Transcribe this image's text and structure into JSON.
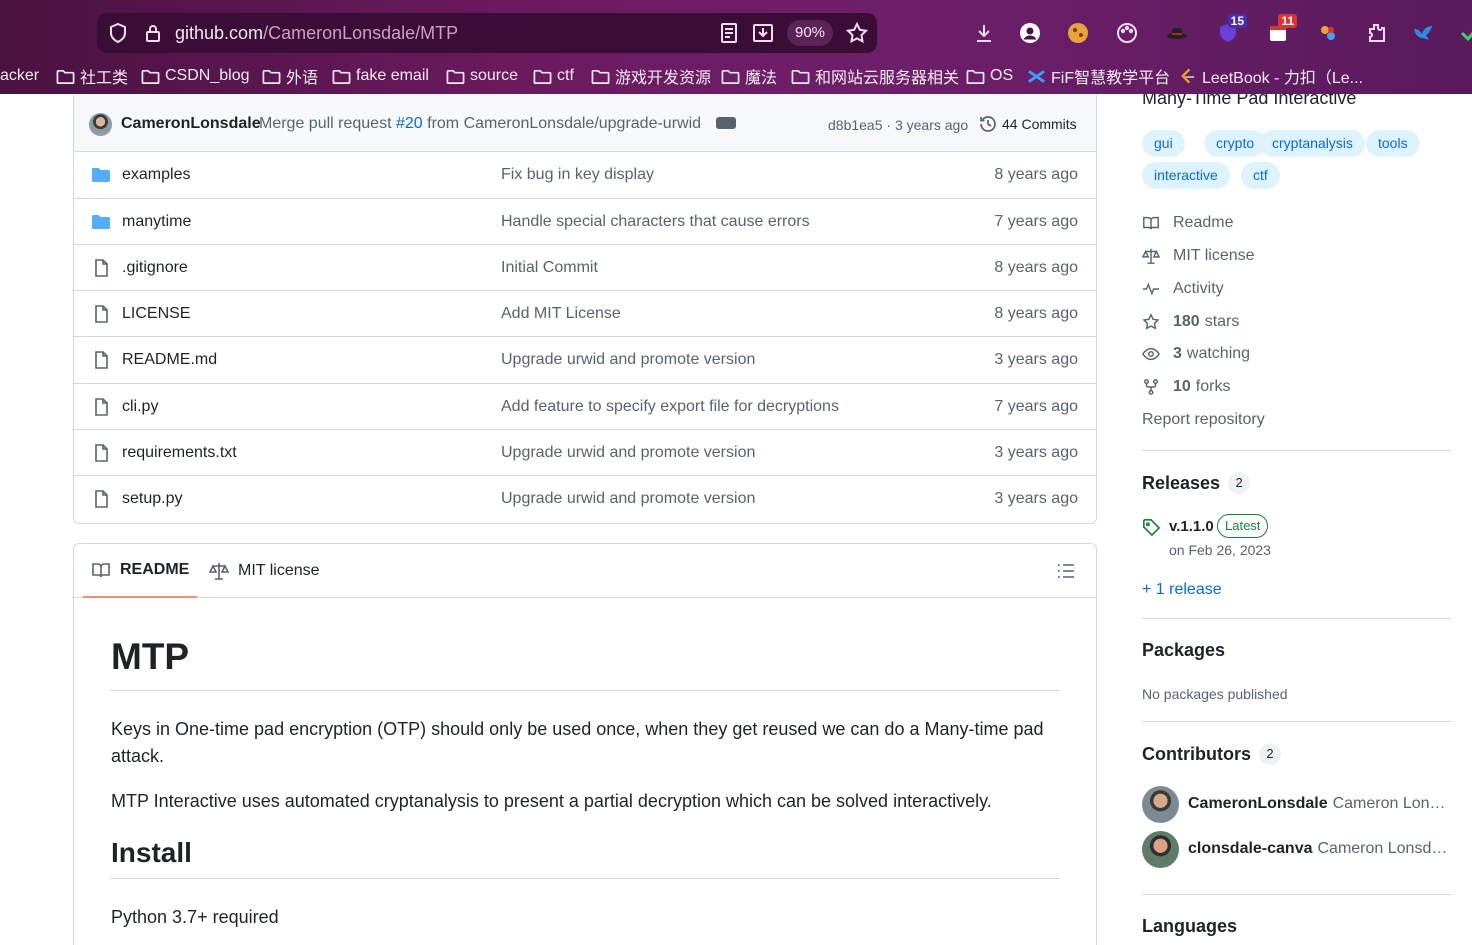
{
  "browser": {
    "url_host": "github.com",
    "url_path": "/CameronLonsdale/MTP",
    "zoom": "90%",
    "extensions": {
      "badge_1": "15",
      "badge_2": "11"
    },
    "bookmarks": [
      {
        "label": "acker",
        "icon": "none"
      },
      {
        "label": "社工类",
        "icon": "folder-icon"
      },
      {
        "label": "CSDN_blog",
        "icon": "folder-icon"
      },
      {
        "label": "外语",
        "icon": "folder-icon"
      },
      {
        "label": "fake email",
        "icon": "folder-icon"
      },
      {
        "label": "source",
        "icon": "folder-icon"
      },
      {
        "label": "ctf",
        "icon": "folder-icon"
      },
      {
        "label": "游戏开发资源",
        "icon": "folder-icon"
      },
      {
        "label": "魔法",
        "icon": "folder-icon"
      },
      {
        "label": "和网站云服务器相关",
        "icon": "folder-icon"
      },
      {
        "label": "OS",
        "icon": "folder-icon"
      },
      {
        "label": "FiF智慧教学平台",
        "icon": "fif-icon"
      },
      {
        "label": "LeetBook - 力扣（Le...",
        "icon": "leetcode-icon"
      }
    ]
  },
  "commit_bar": {
    "user": "CameronLonsdale",
    "message_prefix": "Merge pull request ",
    "pr": "#20",
    "message_suffix": " from CameronLonsdale/upgrade-urwid",
    "sha_age": "d8b1ea5 · 3 years ago",
    "commits": "44 Commits"
  },
  "files": [
    {
      "name": "examples",
      "type": "dir",
      "message": "Fix bug in key display",
      "age": "8 years ago"
    },
    {
      "name": "manytime",
      "type": "dir",
      "message": "Handle special characters that cause errors",
      "age": "7 years ago"
    },
    {
      "name": ".gitignore",
      "type": "file",
      "message": "Initial Commit",
      "age": "8 years ago"
    },
    {
      "name": "LICENSE",
      "type": "file",
      "message": "Add MIT License",
      "age": "8 years ago"
    },
    {
      "name": "README.md",
      "type": "file",
      "message": "Upgrade urwid and promote version",
      "age": "3 years ago"
    },
    {
      "name": "cli.py",
      "type": "file",
      "message": "Add feature to specify export file for decryptions",
      "age": "7 years ago"
    },
    {
      "name": "requirements.txt",
      "type": "file",
      "message": "Upgrade urwid and promote version",
      "age": "3 years ago"
    },
    {
      "name": "setup.py",
      "type": "file",
      "message": "Upgrade urwid and promote version",
      "age": "3 years ago"
    }
  ],
  "readme": {
    "tab_readme": "README",
    "tab_license": "MIT license",
    "h1": "MTP",
    "p1": "Keys in One-time pad encryption (OTP) should only be used once, when they get reused we can do a Many-time pad attack.",
    "p2": "MTP Interactive uses automated cryptanalysis to present a partial decryption which can be solved interactively.",
    "h2": "Install",
    "p3": "Python 3.7+ required"
  },
  "sidebar": {
    "description": "Many-Time Pad Interactive",
    "topics": [
      "gui",
      "crypto",
      "cryptanalysis",
      "tools",
      "interactive",
      "ctf"
    ],
    "links": {
      "readme": "Readme",
      "license": "MIT license",
      "activity": "Activity",
      "stars_count": "180",
      "stars_label": "stars",
      "watching_count": "3",
      "watching_label": "watching",
      "forks_count": "10",
      "forks_label": "forks",
      "report": "Report repository"
    },
    "releases": {
      "title": "Releases",
      "count": "2",
      "version": "v.1.1.0",
      "badge": "Latest",
      "date": "on Feb 26, 2023",
      "more": "+ 1 release"
    },
    "packages": {
      "title": "Packages",
      "empty": "No packages published"
    },
    "contributors": {
      "title": "Contributors",
      "count": "2",
      "list": [
        {
          "login": "CameronLonsdale",
          "name": "Cameron Lonsda..."
        },
        {
          "login": "clonsdale-canva",
          "name": "Cameron Lonsdale"
        }
      ]
    },
    "languages": {
      "title": "Languages"
    }
  },
  "colors": {
    "link": "#0969da",
    "accent_tab": "#fd8c73",
    "latest_green": "#1a7f37",
    "folder": "#54aeff"
  }
}
